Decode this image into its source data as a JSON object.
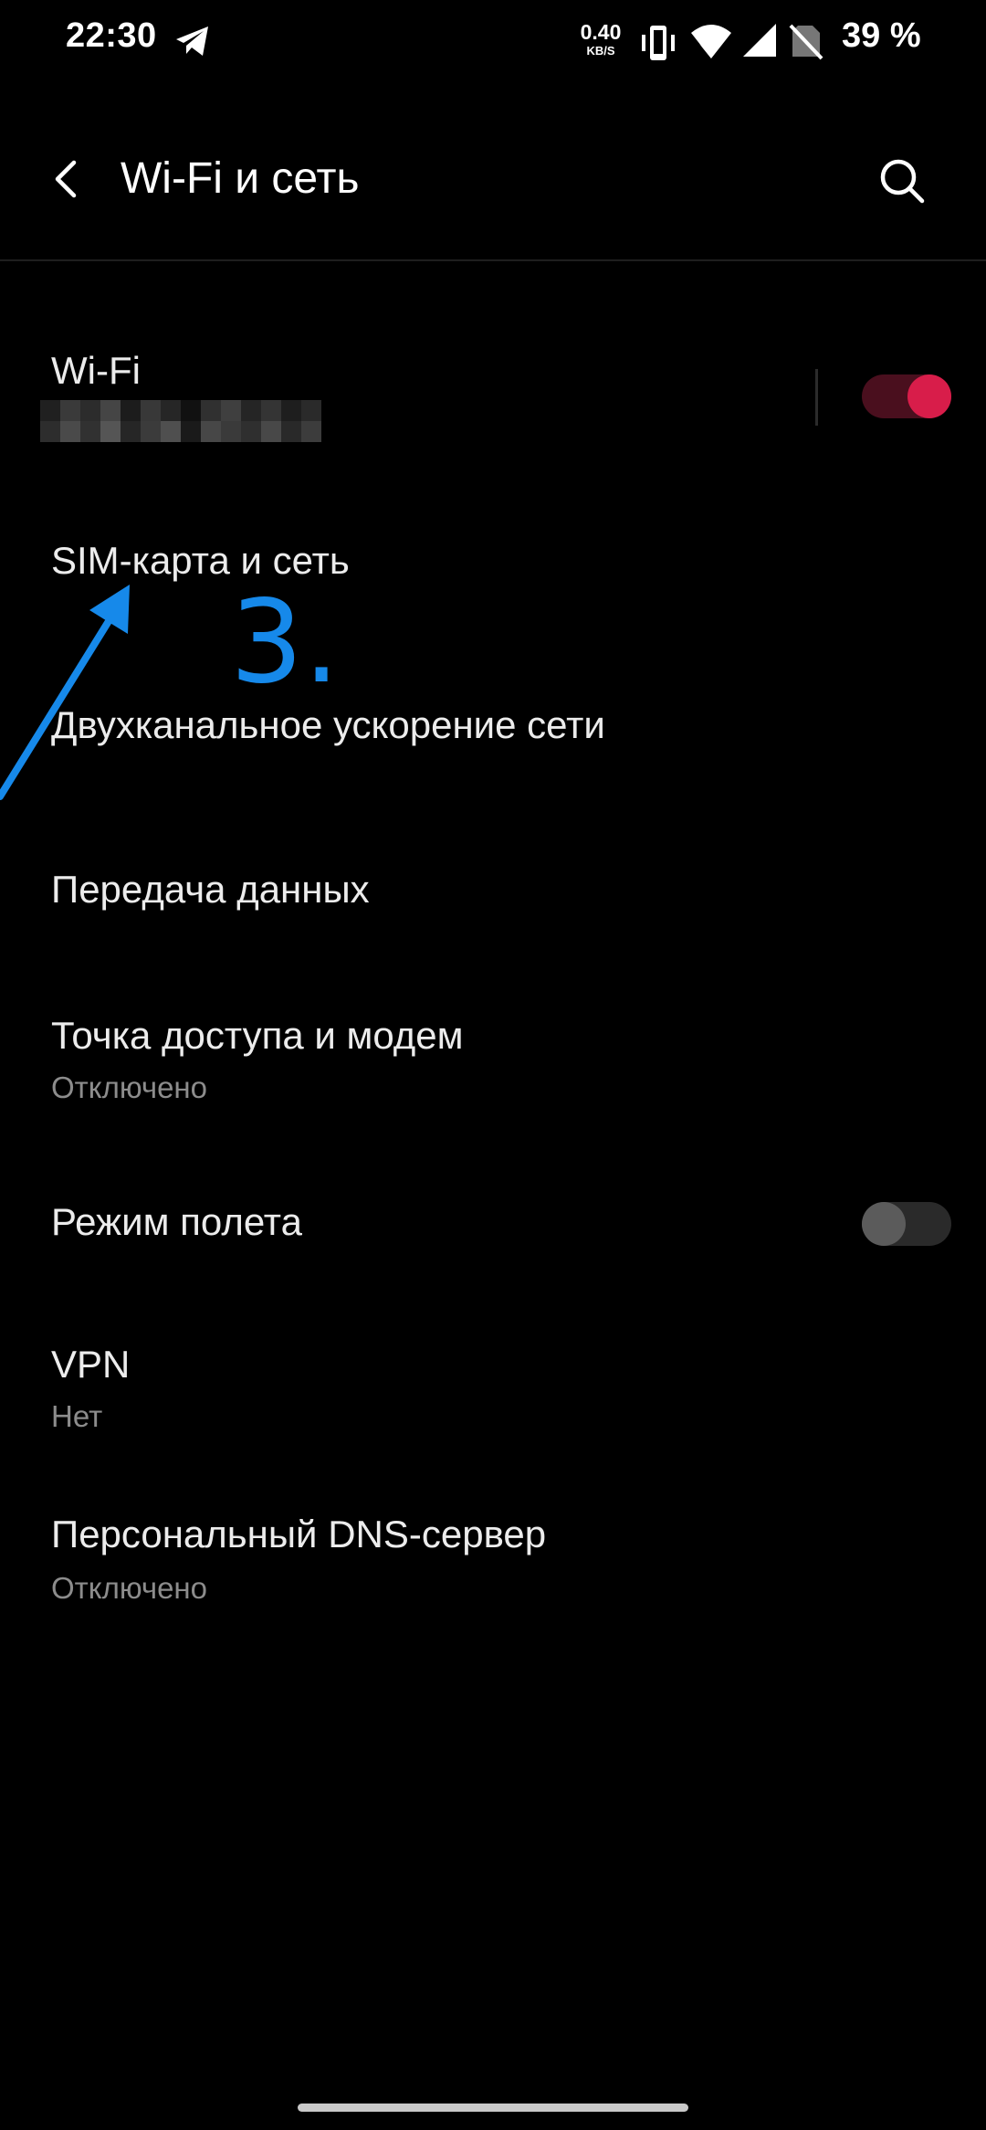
{
  "status_bar": {
    "time": "22:30",
    "net_speed_value": "0.40",
    "net_speed_unit": "KB/S",
    "battery": "39 %",
    "icons": [
      "telegram-icon",
      "vibrate-icon",
      "wifi-signal-icon",
      "cell-signal-icon",
      "no-sim-icon"
    ]
  },
  "toolbar": {
    "title": "Wi-Fi и сеть",
    "back_icon": "chevron-left-icon",
    "search_icon": "search-icon"
  },
  "items": [
    {
      "title": "Wi-Fi",
      "subtitle": "",
      "toggle": true
    },
    {
      "title": "SIM-карта и сеть",
      "subtitle": ""
    },
    {
      "title": "Двухканальное ускорение сети",
      "subtitle": ""
    },
    {
      "title": "Передача данных",
      "subtitle": ""
    },
    {
      "title": "Точка доступа и модем",
      "subtitle": "Отключено"
    },
    {
      "title": "Режим полета",
      "subtitle": "",
      "toggle": false
    },
    {
      "title": "VPN",
      "subtitle": "Нет"
    },
    {
      "title": "Персональный DNS-сервер",
      "subtitle": "Отключено"
    }
  ],
  "annotation": {
    "step_label": "3."
  },
  "colors": {
    "background": "#000000",
    "accent": "#d81d4a",
    "accent_track": "#4a0f1e",
    "annotation": "#1689ea",
    "text_primary": "#ececec",
    "text_secondary": "#8c8c8c"
  }
}
